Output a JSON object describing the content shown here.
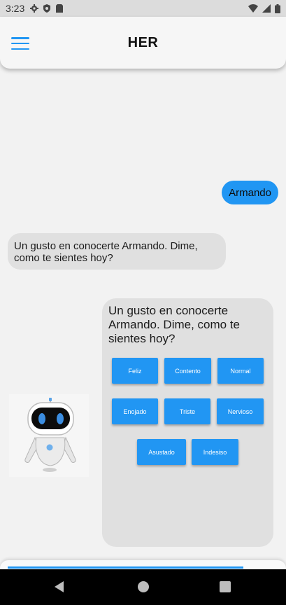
{
  "status_bar": {
    "time": "3:23"
  },
  "app_bar": {
    "title": "HER"
  },
  "chat": {
    "user_message": "Armando",
    "bot_message": "Un gusto en conocerte Armando. Dime, como te sientes hoy?"
  },
  "emotion_card": {
    "prompt": "Un gusto en conocerte Armando. Dime, como te sientes hoy?",
    "options": [
      "Feliz",
      "Contento",
      "Normal",
      "Enojado",
      "Triste",
      "Nervioso",
      "Asustado",
      "Indesiso"
    ]
  },
  "colors": {
    "accent": "#2196f3",
    "bubble": "#e0e0e0",
    "background": "#f2f2f2"
  },
  "icons": [
    "menu-icon",
    "settings-icon",
    "shield-icon",
    "sim-card-icon",
    "wifi-icon",
    "cellular-icon",
    "battery-icon",
    "robot-avatar",
    "back-icon",
    "home-icon",
    "recents-icon"
  ]
}
